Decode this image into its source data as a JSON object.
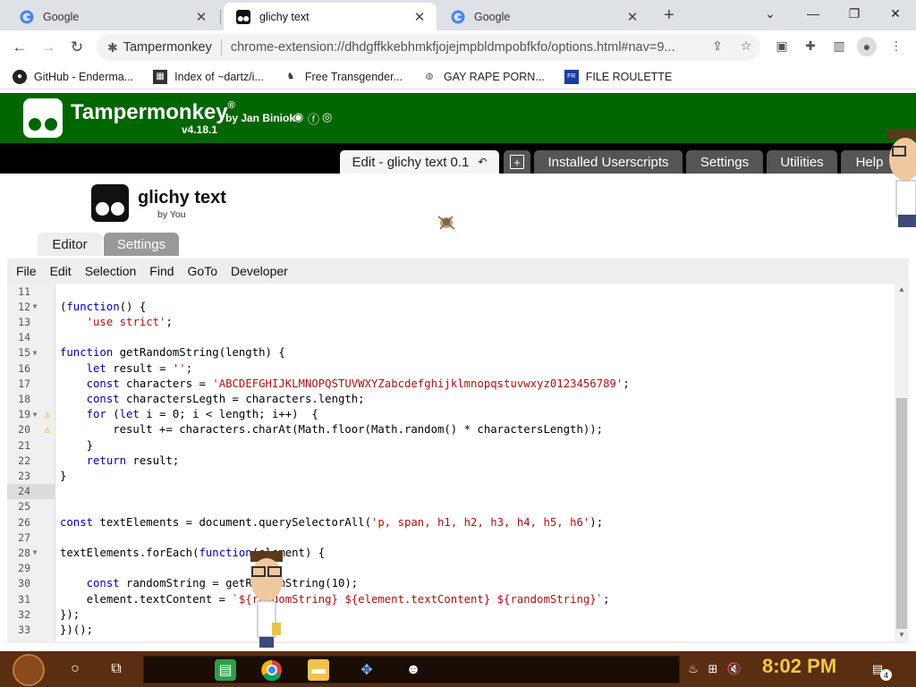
{
  "browser": {
    "tabs": [
      {
        "label": "Google",
        "active": false
      },
      {
        "label": "glichy text",
        "active": true
      },
      {
        "label": "Google",
        "active": false
      }
    ],
    "omnibox": {
      "chip": "Tampermonkey",
      "url": "chrome-extension://dhdgffkkebhmkfjojejmpbldmpobfkfo/options.html#nav=9..."
    },
    "bookmarks": [
      {
        "label": "GitHub - Enderma..."
      },
      {
        "label": "Index of ~dartz/i..."
      },
      {
        "label": "Free Transgender..."
      },
      {
        "label": "GAY RAPE PORN..."
      },
      {
        "label": "FILE ROULETTE"
      }
    ]
  },
  "tampermonkey": {
    "title": "Tampermonkey",
    "reg": "®",
    "by": "by Jan Biniok",
    "version": "v4.18.1",
    "tabs": [
      {
        "label": "Edit - glichy text 0.1"
      },
      {
        "label": "Installed Userscripts"
      },
      {
        "label": "Settings"
      },
      {
        "label": "Utilities"
      },
      {
        "label": "Help"
      }
    ],
    "script": {
      "name": "glichy text",
      "by": "by You"
    },
    "subtabs": {
      "editor": "Editor",
      "settings": "Settings"
    },
    "menu": [
      "File",
      "Edit",
      "Selection",
      "Find",
      "GoTo",
      "Developer"
    ]
  },
  "code_lines": [
    {
      "n": "11",
      "text": ""
    },
    {
      "n": "12",
      "text": "(function() {"
    },
    {
      "n": "13",
      "text": "    'use strict';"
    },
    {
      "n": "14",
      "text": ""
    },
    {
      "n": "15",
      "text": "function getRandomString(length) {"
    },
    {
      "n": "16",
      "text": "    let result = '';"
    },
    {
      "n": "17",
      "text": "    const characters = 'ABCDEFGHIJKLMNOPQSTUVWXYZabcdefghijklmnopqstuvwxyz0123456789';"
    },
    {
      "n": "18",
      "text": "    const charactersLegth = characters.length;"
    },
    {
      "n": "19",
      "text": "    for (let i = 0; i < length; i++)  {"
    },
    {
      "n": "20",
      "text": "        result += characters.charAt(Math.floor(Math.random() * charactersLength));"
    },
    {
      "n": "21",
      "text": "    }"
    },
    {
      "n": "22",
      "text": "    return result;"
    },
    {
      "n": "23",
      "text": "}"
    },
    {
      "n": "24",
      "text": ""
    },
    {
      "n": "25",
      "text": ""
    },
    {
      "n": "26",
      "text": "const textElements = document.querySelectorAll('p, span, h1, h2, h3, h4, h5, h6');"
    },
    {
      "n": "27",
      "text": ""
    },
    {
      "n": "28",
      "text": "textElements.forEach(function(element) {"
    },
    {
      "n": "29",
      "text": ""
    },
    {
      "n": "30",
      "text": "    const randomString = getRandomString(10);"
    },
    {
      "n": "31",
      "text": "    element.textContent = `${randomString} ${element.textContent} ${randomString}`;"
    },
    {
      "n": "32",
      "text": "});"
    },
    {
      "n": "33",
      "text": "})();"
    }
  ],
  "taskbar": {
    "clock": "8:02 PM",
    "notif_count": "4"
  }
}
